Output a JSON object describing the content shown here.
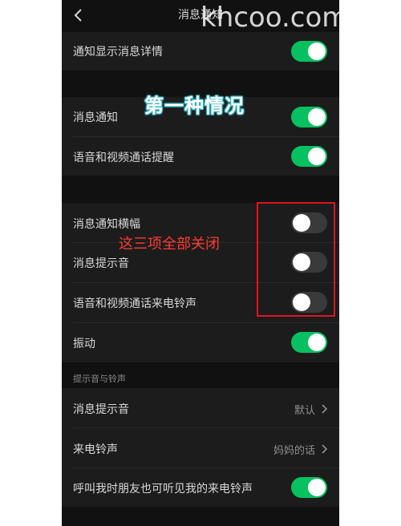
{
  "nav": {
    "title": "消息通知"
  },
  "rows": {
    "show_details": "通知显示消息详情",
    "msg_notify": "消息通知",
    "voice_video_reminder": "语音和视频通话提醒",
    "banner": "消息通知横幅",
    "msg_sound": "消息提示音",
    "ringtone": "语音和视频通话来电铃声",
    "vibrate": "振动",
    "section_header": "提示音与铃声",
    "sound_setting": "消息提示音",
    "sound_value": "默认",
    "incoming_ringtone": "来电铃声",
    "incoming_ringtone_value": "妈妈的话",
    "friends_hear": "呼叫我时朋友也可听见我的来电铃声"
  },
  "toggles": {
    "show_details": true,
    "msg_notify": true,
    "voice_video_reminder": true,
    "banner": false,
    "msg_sound": false,
    "ringtone": false,
    "vibrate": true,
    "friends_hear": true
  },
  "annotations": {
    "watermark": "khcoo.com",
    "title": "第一种情况",
    "note": "这三项全部关闭"
  },
  "colors": {
    "toggle_on": "#07c160",
    "toggle_off": "#3a3a3a",
    "highlight": "#e0151d"
  }
}
